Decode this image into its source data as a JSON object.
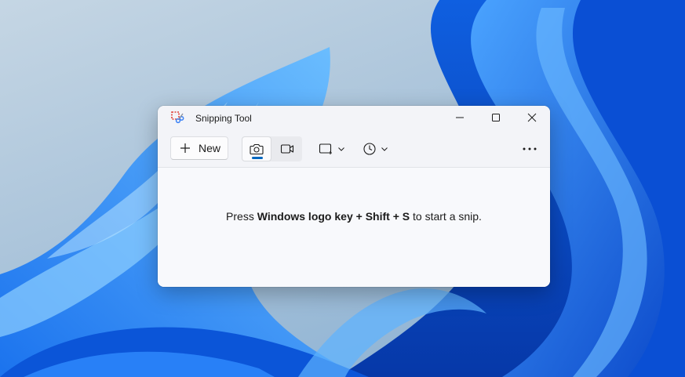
{
  "window": {
    "title": "Snipping Tool",
    "icon": "snipping-tool-icon",
    "controls": [
      "minimize-icon",
      "maximize-icon",
      "close-icon"
    ]
  },
  "toolbar": {
    "new_label": "New",
    "new_icon": "plus-icon",
    "modes": [
      {
        "name": "screenshot",
        "icon": "camera-icon",
        "selected": true
      },
      {
        "name": "record",
        "icon": "video-camera-icon",
        "selected": false
      }
    ],
    "shape_icon": "rectangle-snip-icon",
    "delay_icon": "clock-icon",
    "more_icon": "more-horizontal-icon"
  },
  "content": {
    "hint_prefix": "Press ",
    "hint_keys_1": "Windows logo key",
    "hint_plus_1": " + ",
    "hint_keys_2": "Shift",
    "hint_plus_2": " + ",
    "hint_keys_3": "S",
    "hint_suffix": " to start a snip."
  },
  "colors": {
    "accent": "#0067c0",
    "wallpaper_blue": "#1a6fe8"
  }
}
